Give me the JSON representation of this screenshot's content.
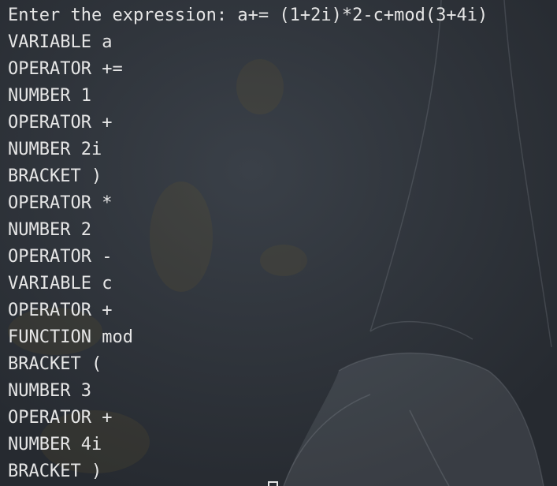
{
  "terminal": {
    "prompt_label": "Enter the expression: ",
    "expression": "a+= (1+2i)*2-c+mod(3+4i)",
    "tokens": [
      {
        "type": "VARIABLE",
        "value": "a"
      },
      {
        "type": "OPERATOR",
        "value": "+="
      },
      {
        "type": "NUMBER",
        "value": "1"
      },
      {
        "type": "OPERATOR",
        "value": "+"
      },
      {
        "type": "NUMBER",
        "value": "2i"
      },
      {
        "type": "BRACKET",
        "value": ")"
      },
      {
        "type": "OPERATOR",
        "value": "*"
      },
      {
        "type": "NUMBER",
        "value": "2"
      },
      {
        "type": "OPERATOR",
        "value": "-"
      },
      {
        "type": "VARIABLE",
        "value": "c"
      },
      {
        "type": "OPERATOR",
        "value": "+"
      },
      {
        "type": "FUNCTION",
        "value": "mod"
      },
      {
        "type": "BRACKET",
        "value": "("
      },
      {
        "type": "NUMBER",
        "value": "3"
      },
      {
        "type": "OPERATOR",
        "value": "+"
      },
      {
        "type": "NUMBER",
        "value": "4i"
      },
      {
        "type": "BRACKET",
        "value": ")"
      }
    ]
  },
  "colors": {
    "background": "#2f343a",
    "text": "#e6e6e6"
  }
}
